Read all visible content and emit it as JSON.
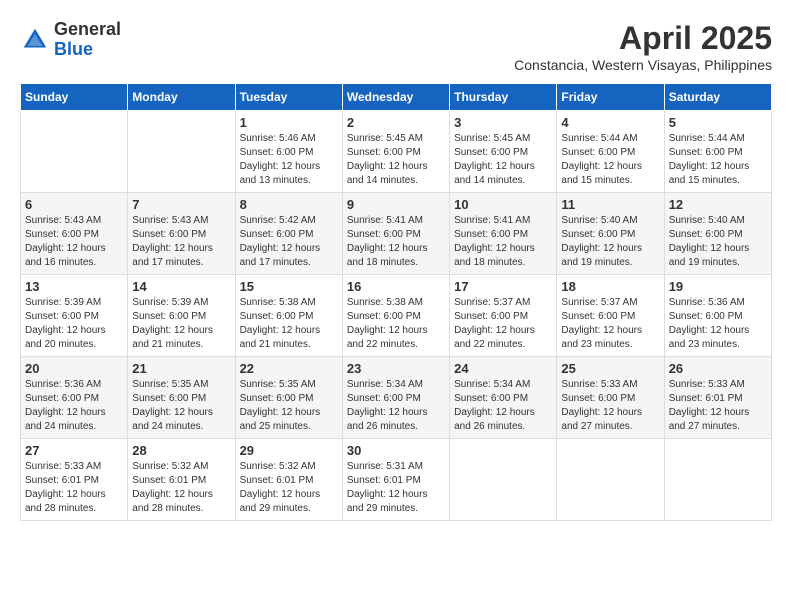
{
  "header": {
    "logo_general": "General",
    "logo_blue": "Blue",
    "month_year": "April 2025",
    "location": "Constancia, Western Visayas, Philippines"
  },
  "days_of_week": [
    "Sunday",
    "Monday",
    "Tuesday",
    "Wednesday",
    "Thursday",
    "Friday",
    "Saturday"
  ],
  "weeks": [
    [
      {
        "day": "",
        "info": ""
      },
      {
        "day": "",
        "info": ""
      },
      {
        "day": "1",
        "info": "Sunrise: 5:46 AM\nSunset: 6:00 PM\nDaylight: 12 hours and 13 minutes."
      },
      {
        "day": "2",
        "info": "Sunrise: 5:45 AM\nSunset: 6:00 PM\nDaylight: 12 hours and 14 minutes."
      },
      {
        "day": "3",
        "info": "Sunrise: 5:45 AM\nSunset: 6:00 PM\nDaylight: 12 hours and 14 minutes."
      },
      {
        "day": "4",
        "info": "Sunrise: 5:44 AM\nSunset: 6:00 PM\nDaylight: 12 hours and 15 minutes."
      },
      {
        "day": "5",
        "info": "Sunrise: 5:44 AM\nSunset: 6:00 PM\nDaylight: 12 hours and 15 minutes."
      }
    ],
    [
      {
        "day": "6",
        "info": "Sunrise: 5:43 AM\nSunset: 6:00 PM\nDaylight: 12 hours and 16 minutes."
      },
      {
        "day": "7",
        "info": "Sunrise: 5:43 AM\nSunset: 6:00 PM\nDaylight: 12 hours and 17 minutes."
      },
      {
        "day": "8",
        "info": "Sunrise: 5:42 AM\nSunset: 6:00 PM\nDaylight: 12 hours and 17 minutes."
      },
      {
        "day": "9",
        "info": "Sunrise: 5:41 AM\nSunset: 6:00 PM\nDaylight: 12 hours and 18 minutes."
      },
      {
        "day": "10",
        "info": "Sunrise: 5:41 AM\nSunset: 6:00 PM\nDaylight: 12 hours and 18 minutes."
      },
      {
        "day": "11",
        "info": "Sunrise: 5:40 AM\nSunset: 6:00 PM\nDaylight: 12 hours and 19 minutes."
      },
      {
        "day": "12",
        "info": "Sunrise: 5:40 AM\nSunset: 6:00 PM\nDaylight: 12 hours and 19 minutes."
      }
    ],
    [
      {
        "day": "13",
        "info": "Sunrise: 5:39 AM\nSunset: 6:00 PM\nDaylight: 12 hours and 20 minutes."
      },
      {
        "day": "14",
        "info": "Sunrise: 5:39 AM\nSunset: 6:00 PM\nDaylight: 12 hours and 21 minutes."
      },
      {
        "day": "15",
        "info": "Sunrise: 5:38 AM\nSunset: 6:00 PM\nDaylight: 12 hours and 21 minutes."
      },
      {
        "day": "16",
        "info": "Sunrise: 5:38 AM\nSunset: 6:00 PM\nDaylight: 12 hours and 22 minutes."
      },
      {
        "day": "17",
        "info": "Sunrise: 5:37 AM\nSunset: 6:00 PM\nDaylight: 12 hours and 22 minutes."
      },
      {
        "day": "18",
        "info": "Sunrise: 5:37 AM\nSunset: 6:00 PM\nDaylight: 12 hours and 23 minutes."
      },
      {
        "day": "19",
        "info": "Sunrise: 5:36 AM\nSunset: 6:00 PM\nDaylight: 12 hours and 23 minutes."
      }
    ],
    [
      {
        "day": "20",
        "info": "Sunrise: 5:36 AM\nSunset: 6:00 PM\nDaylight: 12 hours and 24 minutes."
      },
      {
        "day": "21",
        "info": "Sunrise: 5:35 AM\nSunset: 6:00 PM\nDaylight: 12 hours and 24 minutes."
      },
      {
        "day": "22",
        "info": "Sunrise: 5:35 AM\nSunset: 6:00 PM\nDaylight: 12 hours and 25 minutes."
      },
      {
        "day": "23",
        "info": "Sunrise: 5:34 AM\nSunset: 6:00 PM\nDaylight: 12 hours and 26 minutes."
      },
      {
        "day": "24",
        "info": "Sunrise: 5:34 AM\nSunset: 6:00 PM\nDaylight: 12 hours and 26 minutes."
      },
      {
        "day": "25",
        "info": "Sunrise: 5:33 AM\nSunset: 6:00 PM\nDaylight: 12 hours and 27 minutes."
      },
      {
        "day": "26",
        "info": "Sunrise: 5:33 AM\nSunset: 6:01 PM\nDaylight: 12 hours and 27 minutes."
      }
    ],
    [
      {
        "day": "27",
        "info": "Sunrise: 5:33 AM\nSunset: 6:01 PM\nDaylight: 12 hours and 28 minutes."
      },
      {
        "day": "28",
        "info": "Sunrise: 5:32 AM\nSunset: 6:01 PM\nDaylight: 12 hours and 28 minutes."
      },
      {
        "day": "29",
        "info": "Sunrise: 5:32 AM\nSunset: 6:01 PM\nDaylight: 12 hours and 29 minutes."
      },
      {
        "day": "30",
        "info": "Sunrise: 5:31 AM\nSunset: 6:01 PM\nDaylight: 12 hours and 29 minutes."
      },
      {
        "day": "",
        "info": ""
      },
      {
        "day": "",
        "info": ""
      },
      {
        "day": "",
        "info": ""
      }
    ]
  ]
}
